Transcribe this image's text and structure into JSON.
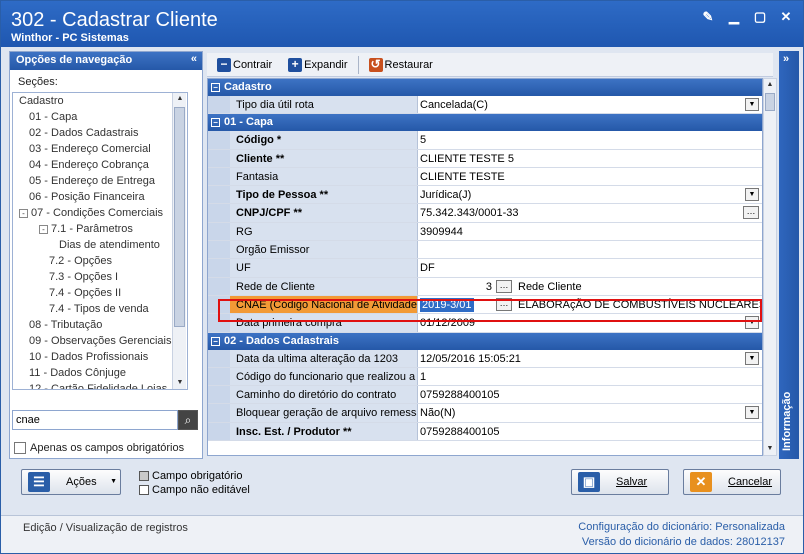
{
  "window": {
    "title": "302 - Cadastrar Cliente",
    "subtitle": "Winthor - PC Sistemas"
  },
  "nav": {
    "header": "Opções de navegação",
    "sections_label": "Seções:",
    "items": [
      {
        "label": "Cadastro",
        "indent": 0,
        "expander": ""
      },
      {
        "label": "01 - Capa",
        "indent": 1,
        "expander": ""
      },
      {
        "label": "02 - Dados Cadastrais",
        "indent": 1,
        "expander": ""
      },
      {
        "label": "03 - Endereço Comercial",
        "indent": 1,
        "expander": ""
      },
      {
        "label": "04 - Endereço Cobrança",
        "indent": 1,
        "expander": ""
      },
      {
        "label": "05 - Endereço de Entrega",
        "indent": 1,
        "expander": ""
      },
      {
        "label": "06 - Posição Financeira",
        "indent": 1,
        "expander": ""
      },
      {
        "label": "07 - Condições Comerciais",
        "indent": 0,
        "expander": "-"
      },
      {
        "label": "7.1 - Parâmetros",
        "indent": 2,
        "expander": "-"
      },
      {
        "label": "Dias de atendimento",
        "indent": 4,
        "expander": ""
      },
      {
        "label": "7.2 - Opções",
        "indent": 3,
        "expander": ""
      },
      {
        "label": "7.3 - Opções I",
        "indent": 3,
        "expander": ""
      },
      {
        "label": "7.4 - Opções II",
        "indent": 3,
        "expander": ""
      },
      {
        "label": "7.4 - Tipos de venda",
        "indent": 3,
        "expander": ""
      },
      {
        "label": "08 - Tributação",
        "indent": 1,
        "expander": ""
      },
      {
        "label": "09 - Observações Gerenciais",
        "indent": 1,
        "expander": ""
      },
      {
        "label": "10 - Dados Profissionais",
        "indent": 1,
        "expander": ""
      },
      {
        "label": "11 - Dados Cônjuge",
        "indent": 1,
        "expander": ""
      },
      {
        "label": "12 - Cartão Fidelidade Lojas",
        "indent": 1,
        "expander": ""
      }
    ],
    "search_value": "cnae",
    "only_required_label": "Apenas os campos obrigatórios"
  },
  "toolbar": {
    "collapse": "Contrair",
    "expand": "Expandir",
    "restore": "Restaurar"
  },
  "grid": {
    "cadastro": {
      "title": "Cadastro",
      "rows": [
        {
          "label": "Tipo dia útil rota",
          "value": "Cancelada(C)",
          "bold": false,
          "dd": true
        }
      ]
    },
    "capa": {
      "title": "01 - Capa",
      "rows": [
        {
          "label": "Código *",
          "value": "5",
          "bold": true
        },
        {
          "label": "Cliente **",
          "value": "CLIENTE TESTE 5",
          "bold": true
        },
        {
          "label": "Fantasia",
          "value": "CLIENTE TESTE",
          "bold": false
        },
        {
          "label": "Tipo de Pessoa **",
          "value": "Jurídica(J)",
          "bold": true,
          "dd": true
        },
        {
          "label": "CNPJ/CPF **",
          "value": "75.342.343/0001-33",
          "bold": true,
          "ellip": true
        },
        {
          "label": "RG",
          "value": "3909944",
          "bold": false
        },
        {
          "label": "Orgão Emissor",
          "value": "",
          "bold": false
        },
        {
          "label": "UF",
          "value": "DF",
          "bold": false
        }
      ],
      "rede": {
        "label": "Rede de Cliente",
        "code": "3",
        "desc": "Rede Cliente"
      },
      "cnae": {
        "label": "CNAE (Código Nacional de Atividade E",
        "code": "2019-3/01",
        "desc": "ELABORAçÃO DE COMBUSTÍVEIS NUCLEARES"
      },
      "after": [
        {
          "label": "Data primeira compra",
          "value": "01/12/2009",
          "bold": false,
          "dd": true
        }
      ]
    },
    "dados": {
      "title": "02 - Dados Cadastrais",
      "rows": [
        {
          "label": "Data da ultima alteração da 1203",
          "value": "12/05/2016 15:05:21",
          "bold": false,
          "dd": true
        },
        {
          "label": "Código do funcionario que realizou a ú",
          "value": "1",
          "bold": false
        },
        {
          "label": "Caminho do diretório do contrato",
          "value": "0759288400105",
          "bold": false
        },
        {
          "label": "Bloquear geração de arquivo remessa",
          "value": "Não(N)",
          "bold": false,
          "dd": true
        },
        {
          "label": "Insc. Est. / Produtor **",
          "value": "0759288400105",
          "bold": true
        }
      ]
    }
  },
  "info_panel": "Informação",
  "bottom": {
    "actions": "Ações",
    "legend_required": "Campo obrigatório",
    "legend_noneditable": "Campo não editável",
    "save": "Salvar",
    "cancel": "Cancelar"
  },
  "status": {
    "left": "Edição / Visualização de registros",
    "dict_config_label": "Configuração do dicionário:",
    "dict_config_value": "Personalizada",
    "dict_version_label": "Versão do dicionário de dados:",
    "dict_version_value": "28012137"
  },
  "colors": {
    "accent": "#2558a8",
    "highlight": "#e01010",
    "cnae_label": "#f29a36"
  }
}
